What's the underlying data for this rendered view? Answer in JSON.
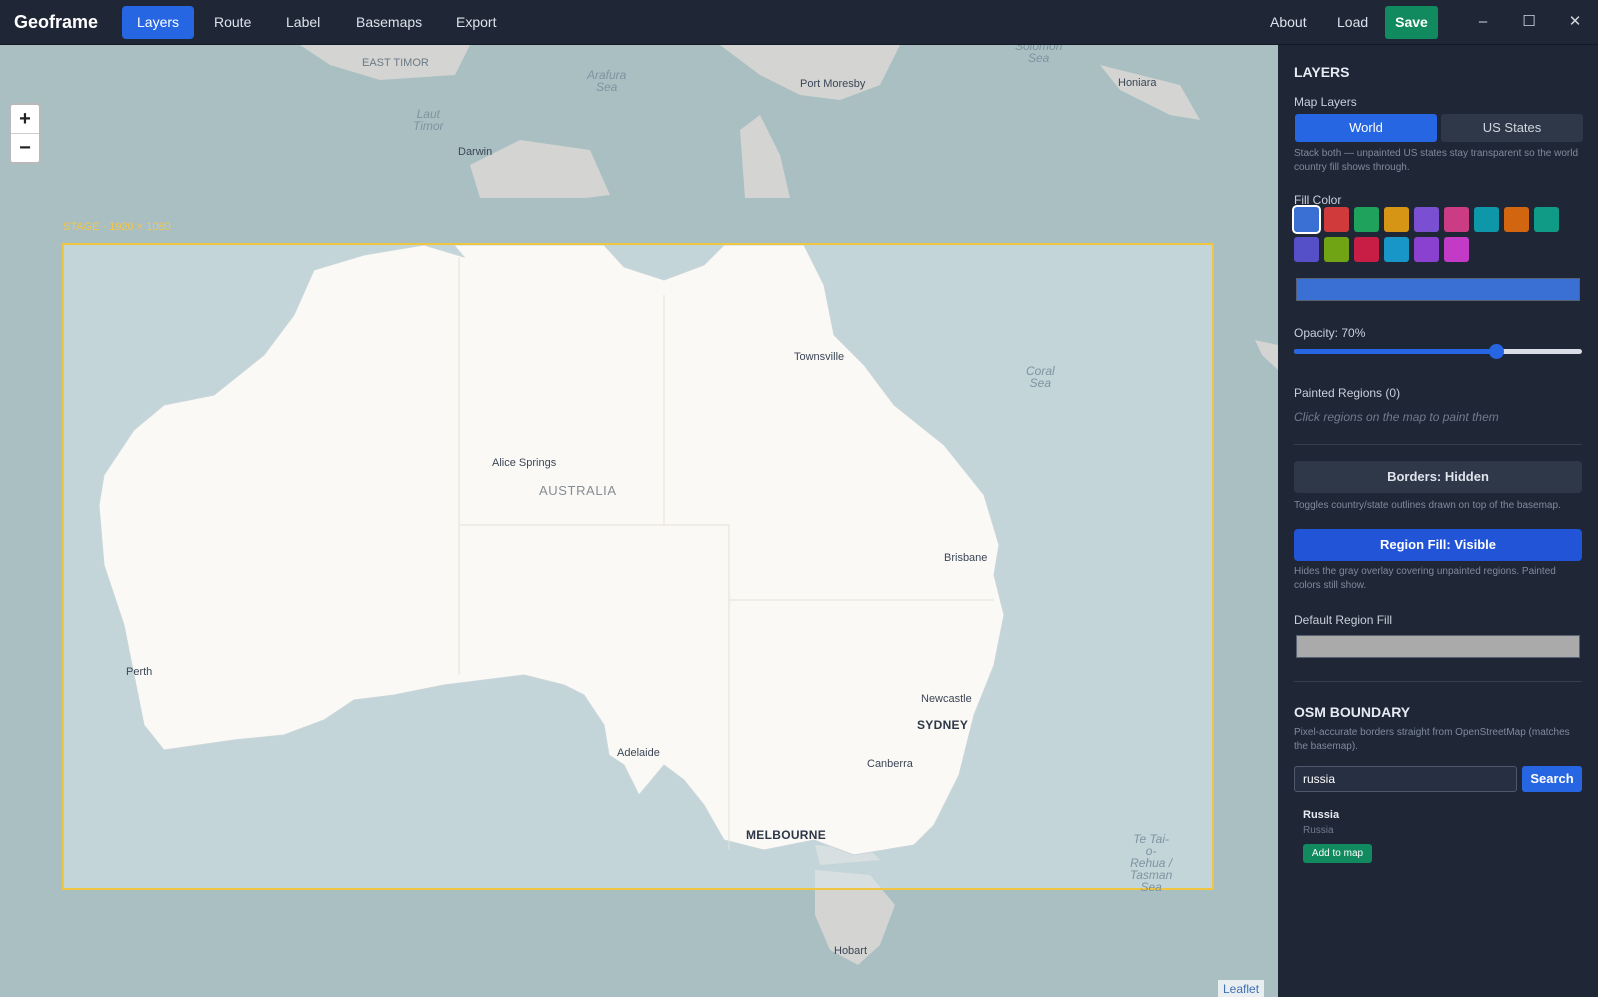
{
  "app": {
    "title": "Geoframe"
  },
  "nav": {
    "tabs": [
      "Layers",
      "Route",
      "Label",
      "Basemaps",
      "Export"
    ],
    "active": "Layers"
  },
  "toolbar": {
    "about": "About",
    "load": "Load",
    "save": "Save"
  },
  "window_controls": {
    "minimize": "–",
    "maximize": "☐",
    "close": "✕"
  },
  "map": {
    "zoom_in": "+",
    "zoom_out": "−",
    "stage_label": "STAGE · 1920 × 1080",
    "attribution": "Leaflet",
    "country": "AUSTRALIA",
    "cities": {
      "darwin": "Darwin",
      "port_moresby": "Port Moresby",
      "honiara": "Honiara",
      "townsville": "Townsville",
      "alice_springs": "Alice Springs",
      "brisbane": "Brisbane",
      "perth": "Perth",
      "newcastle": "Newcastle",
      "sydney": "SYDNEY",
      "adelaide": "Adelaide",
      "canberra": "Canberra",
      "melbourne": "MELBOURNE",
      "hobart": "Hobart"
    },
    "seas": {
      "east_timor": "EAST TIMOR",
      "arafura": "Arafura\nSea",
      "laut_timor": "Laut\nTimor",
      "solomon": "Solomon\nSea",
      "coral": "Coral\nSea",
      "tasman": "Te Tai-\no-\nRehua /\nTasman\nSea"
    }
  },
  "panel": {
    "title": "LAYERS",
    "map_layers_label": "Map Layers",
    "layers": [
      "World",
      "US States"
    ],
    "active_layer": "World",
    "layers_hint": "Stack both — unpainted US states stay transparent so the world country fill shows through.",
    "fill_color_label": "Fill Color",
    "swatches": [
      "#3a6fd3",
      "#d03a3a",
      "#1fa35c",
      "#d79515",
      "#7b4fd1",
      "#cc3c84",
      "#0d97a8",
      "#d2650f",
      "#109b86",
      "#5650c8",
      "#70a414",
      "#c81e45",
      "#1796c7",
      "#8a41cf",
      "#c23ac5"
    ],
    "selected_color": "#3a6fd3",
    "opacity_label": "Opacity: 70%",
    "opacity": 0.7,
    "painted_regions_label": "Painted Regions (0)",
    "painted_hint": "Click regions on the map to paint them",
    "borders_btn": "Borders: Hidden",
    "borders_hint": "Toggles country/state outlines drawn on top of the basemap.",
    "region_fill_btn": "Region Fill: Visible",
    "region_fill_hint": "Hides the gray overlay covering unpainted regions. Painted colors still show.",
    "default_region_fill_label": "Default Region Fill",
    "default_region_fill": "#aaaaaa",
    "osm_title": "OSM BOUNDARY",
    "osm_hint": "Pixel-accurate borders straight from OpenStreetMap (matches the basemap).",
    "search_value": "russia",
    "search_btn": "Search",
    "result_title": "Russia",
    "result_sub": "Russia",
    "add_btn": "Add to map"
  }
}
